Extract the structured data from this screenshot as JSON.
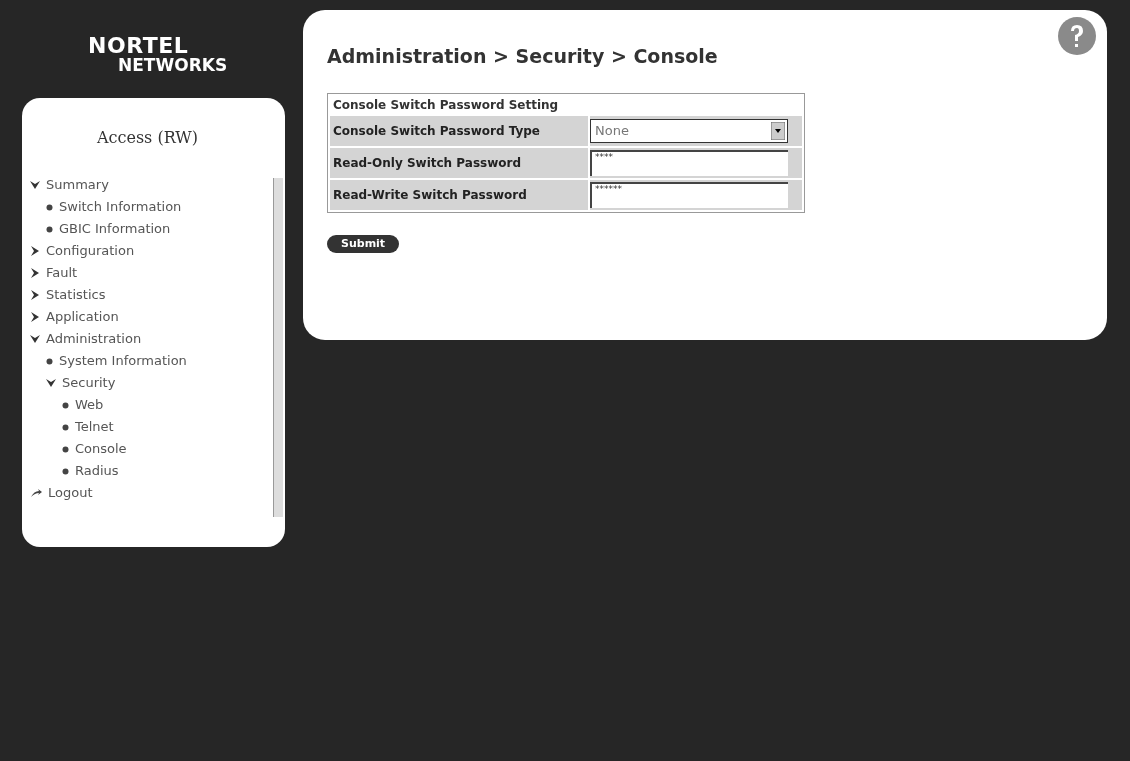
{
  "logo": {
    "line_1": "NORTEL",
    "line_2": "NETWORKS"
  },
  "sidebar": {
    "title": "Access (RW)",
    "items": [
      {
        "label": "Summary",
        "kind": "folder",
        "expanded": true,
        "children": [
          {
            "label": "Switch Information",
            "kind": "page"
          },
          {
            "label": "GBIC Information",
            "kind": "page"
          }
        ]
      },
      {
        "label": "Configuration",
        "kind": "folder",
        "expanded": false
      },
      {
        "label": "Fault",
        "kind": "folder",
        "expanded": false
      },
      {
        "label": "Statistics",
        "kind": "folder",
        "expanded": false
      },
      {
        "label": "Application",
        "kind": "folder",
        "expanded": false
      },
      {
        "label": "Administration",
        "kind": "folder",
        "expanded": true,
        "children": [
          {
            "label": "System Information",
            "kind": "page"
          },
          {
            "label": "Security",
            "kind": "folder",
            "expanded": true,
            "children": [
              {
                "label": "Web",
                "kind": "page"
              },
              {
                "label": "Telnet",
                "kind": "page"
              },
              {
                "label": "Console",
                "kind": "page"
              },
              {
                "label": "Radius",
                "kind": "page"
              }
            ]
          }
        ]
      },
      {
        "label": "Logout",
        "kind": "logout"
      }
    ]
  },
  "main": {
    "breadcrumb": "Administration > Security > Console",
    "form": {
      "title": "Console Switch Password Setting",
      "rows": [
        {
          "label": "Console Switch Password Type",
          "kind": "select",
          "value": "None"
        },
        {
          "label": "Read-Only Switch Password",
          "kind": "password",
          "value": "****"
        },
        {
          "label": "Read-Write Switch Password",
          "kind": "password",
          "value": "******"
        }
      ]
    },
    "submit": "Submit"
  }
}
